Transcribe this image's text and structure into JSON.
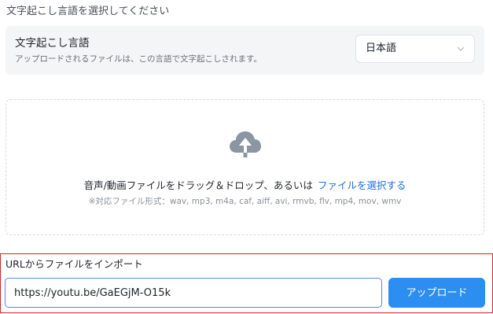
{
  "section": {
    "title": "文字起こし言語を選択してください"
  },
  "language": {
    "title": "文字起こし言語",
    "description": "アップロードされるファイルは、この言語で文字起こしされます。",
    "selected": "日本語"
  },
  "dropzone": {
    "icon": "cloud-upload-icon",
    "text": "音声/動画ファイルをドラッグ＆ドロップ、あるいは",
    "link": "ファイルを選択する",
    "formats": "※対応ファイル形式：wav, mp3, m4a, caf, aiff, avi, rmvb, flv, mp4, mov, wmv"
  },
  "url_import": {
    "label": "URLからファイルをインポート",
    "value": "https://youtu.be/GaEGjM-O15k",
    "button": "アップロード"
  },
  "colors": {
    "accent": "#2b8ef0",
    "link": "#1e6fd9",
    "highlight_border": "#d0262b",
    "card_bg": "#f4f5f7"
  }
}
